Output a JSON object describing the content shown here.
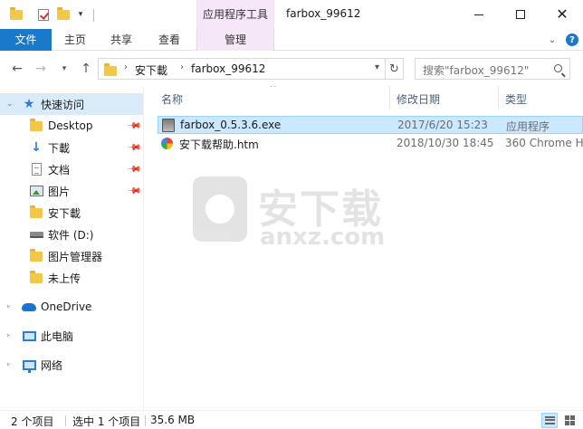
{
  "window": {
    "title": "farbox_99612",
    "context_tab_header": "应用程序工具",
    "qa_dropdown": "▾"
  },
  "ribbon": {
    "tabs": [
      "文件",
      "主页",
      "共享",
      "查看",
      "管理"
    ],
    "collapse": "⌄",
    "help": "?"
  },
  "address": {
    "crumbs": [
      "安下載",
      "farbox_99612"
    ],
    "search_placeholder": "搜索\"farbox_99612\""
  },
  "sidebar": {
    "items": [
      {
        "label": "快速访问",
        "icon": "star-icon"
      },
      {
        "label": "Desktop",
        "icon": "folder-icon"
      },
      {
        "label": "下載",
        "icon": "download-icon"
      },
      {
        "label": "文档",
        "icon": "document-icon"
      },
      {
        "label": "图片",
        "icon": "picture-icon"
      },
      {
        "label": "安下載",
        "icon": "folder-icon"
      },
      {
        "label": "软件 (D:)",
        "icon": "drive-icon"
      },
      {
        "label": "图片管理器",
        "icon": "folder-icon"
      },
      {
        "label": "未上传",
        "icon": "folder-icon"
      },
      {
        "label": "OneDrive",
        "icon": "onedrive-icon"
      },
      {
        "label": "此电脑",
        "icon": "pc-icon"
      },
      {
        "label": "网络",
        "icon": "network-icon"
      }
    ]
  },
  "filelist": {
    "columns": [
      "名称",
      "修改日期",
      "类型"
    ],
    "rows": [
      {
        "name": "farbox_0.5.3.6.exe",
        "date": "2017/6/20 15:23",
        "type": "应用程序",
        "icon": "exe-icon",
        "selected": true
      },
      {
        "name": "安下载帮助.htm",
        "date": "2018/10/30 18:45",
        "type": "360 Chrome H",
        "icon": "chrome-html-icon",
        "selected": false
      }
    ]
  },
  "watermark": {
    "text": "安下载",
    "sub": "anxz.com"
  },
  "status": {
    "count": "2 个项目",
    "selected": "选中 1 个项目",
    "size": "35.6 MB"
  },
  "colors": {
    "accent": "#1979ca",
    "context_tab": "#f6e7f8",
    "selection": "#cce8ff"
  }
}
